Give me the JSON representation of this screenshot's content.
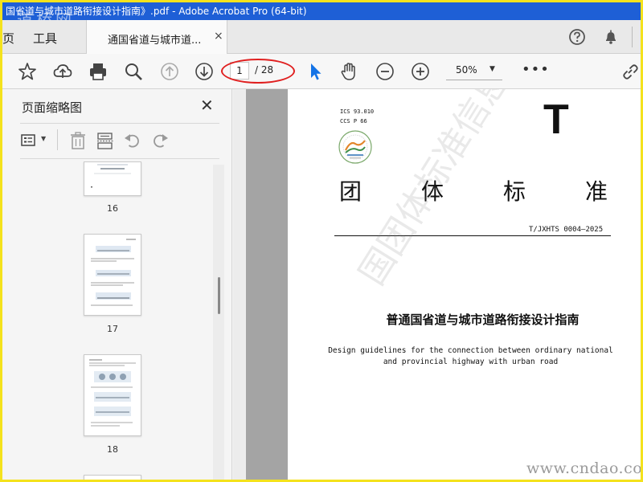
{
  "window": {
    "title": "国省道与城市道路衔接设计指南》.pdf - Adobe Acrobat Pro (64-bit)",
    "watermark_logo": "道桥网"
  },
  "tabs": {
    "home_label": "页",
    "tools_label": "工具",
    "doc_label": "通国省道与城市道...",
    "close_glyph": "×"
  },
  "toolbar": {
    "current_page": "1",
    "page_total": "/ 28",
    "zoom": "50%",
    "more": "•••"
  },
  "panel": {
    "title": "页面缩略图",
    "close_glyph": "✕"
  },
  "thumbnails": [
    {
      "label": "16"
    },
    {
      "label": "17"
    },
    {
      "label": "18"
    }
  ],
  "document": {
    "ics": "ICS 93.010",
    "ccs": "CCS P 66",
    "big_t": "T",
    "heading_chars": [
      "团",
      "体",
      "标",
      "准"
    ],
    "standard_number": "T/JXHTS 0004—2025",
    "title_zh": "普通国省道与城市道路衔接设计指南",
    "title_en_line1": "Design guidelines for the connection between ordinary national",
    "title_en_line2": "and provincial highway with urban road",
    "watermark_diag": "国团体标准信息平台",
    "watermark_url": "www.cndao.com"
  },
  "colors": {
    "titlebar": "#1e5fd6",
    "select_tool": "#1473e6",
    "annotation_oval": "#e02020",
    "frame_border": "#f4e21d"
  }
}
